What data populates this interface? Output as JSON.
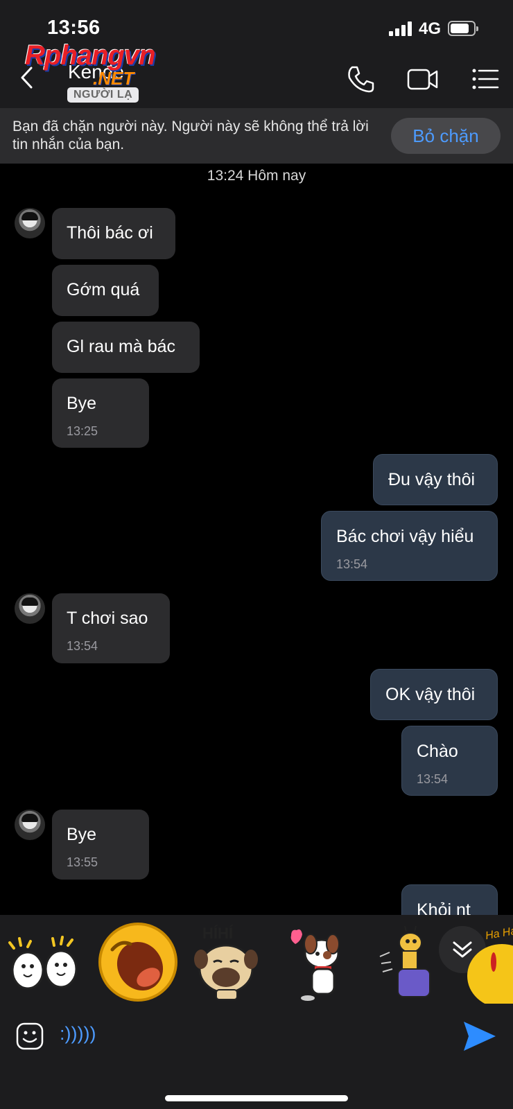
{
  "status_bar": {
    "time": "13:56",
    "network": "4G",
    "battery_level": 0.8
  },
  "header": {
    "contact_name": "Kendé",
    "stranger_badge": "NGƯỜI LẠ",
    "watermark_main": "Rphangvn",
    "watermark_sub": ".NET",
    "icons": [
      "back-chevron-icon",
      "phone-icon",
      "video-call-icon",
      "menu-list-icon"
    ]
  },
  "blocked_banner": {
    "text": "Bạn đã chặn người này. Người này sẽ không thể trả lời tin nhắn của bạn.",
    "unblock_label": "Bỏ chặn"
  },
  "conversation": {
    "date_separator": "13:24 Hôm nay",
    "messages": [
      {
        "dir": "in",
        "text": "Thôi bác ơi"
      },
      {
        "dir": "in",
        "text": "Gớm quá"
      },
      {
        "dir": "in",
        "text": "Gl rau mà bác"
      },
      {
        "dir": "in",
        "text": "Bye",
        "time": "13:25"
      },
      {
        "dir": "out",
        "text": "Đu vậy thôi"
      },
      {
        "dir": "out",
        "text": "Bác chơi vậy hiểu",
        "time": "13:54"
      },
      {
        "dir": "in",
        "text": "T chơi sao",
        "time": "13:54"
      },
      {
        "dir": "out",
        "text": "OK vậy thôi"
      },
      {
        "dir": "out",
        "text": "Chào",
        "time": "13:54"
      },
      {
        "dir": "in",
        "text": "Bye",
        "time": "13:55"
      },
      {
        "dir": "out",
        "text": "Khỏi nt"
      }
    ]
  },
  "sticker_bar": {
    "stickers": [
      {
        "name": "bouncing-egg-characters-sticker"
      },
      {
        "name": "laughing-emoji-sticker"
      },
      {
        "name": "pug-hihi-sticker",
        "caption": "HÍHÍ"
      },
      {
        "name": "dog-with-heart-sticker"
      },
      {
        "name": "giraffe-sticker"
      },
      {
        "name": "haha-yellow-sticker",
        "caption": "Ha Ha"
      }
    ]
  },
  "composer": {
    "value": ":)))))"
  },
  "colors": {
    "accent": "#4d9bff",
    "incoming_bubble": "#2c2c2e",
    "outgoing_bubble": "#2c3848",
    "bar_bg": "#1c1c1e"
  }
}
